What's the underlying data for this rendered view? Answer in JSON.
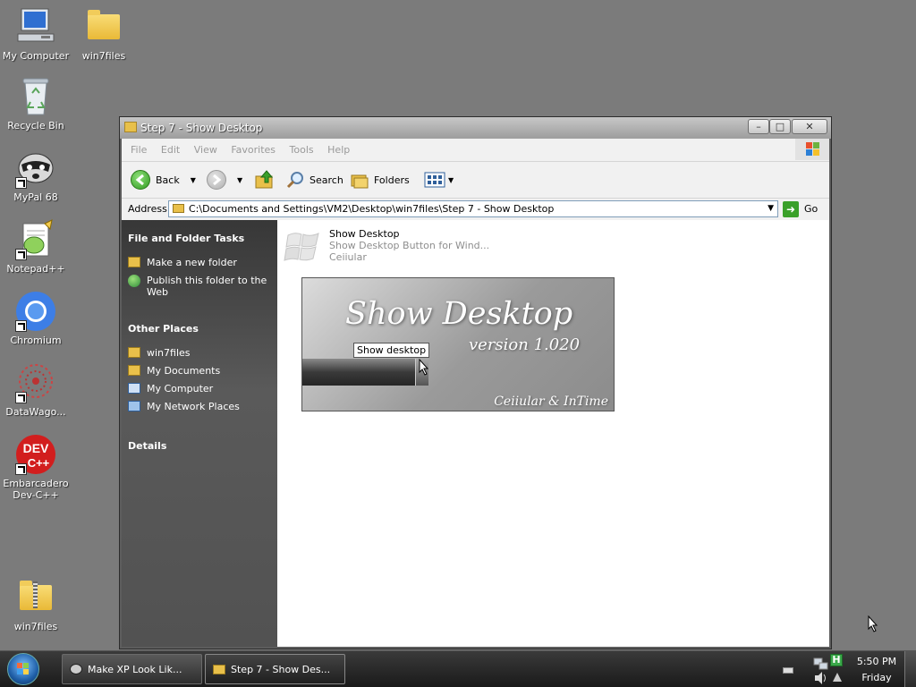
{
  "desktop": {
    "icons": [
      {
        "label": "My Computer"
      },
      {
        "label": "win7files"
      },
      {
        "label": "Recycle Bin"
      },
      {
        "label": "MyPal 68"
      },
      {
        "label": "Notepad++"
      },
      {
        "label": "Chromium"
      },
      {
        "label": "DataWago..."
      },
      {
        "label": "Embarcadero Dev-C++"
      },
      {
        "label": "win7files"
      }
    ]
  },
  "window": {
    "title": "Step 7 - Show Desktop",
    "menu": [
      "File",
      "Edit",
      "View",
      "Favorites",
      "Tools",
      "Help"
    ],
    "toolbar": {
      "back": "Back",
      "search": "Search",
      "folders": "Folders"
    },
    "address": {
      "label": "Address",
      "path": "C:\\Documents and Settings\\VM2\\Desktop\\win7files\\Step 7 - Show Desktop",
      "go": "Go"
    },
    "left_pane": {
      "tasks_heading": "File and Folder Tasks",
      "tasks": [
        "Make a new folder",
        "Publish this folder to the Web"
      ],
      "places_heading": "Other Places",
      "places": [
        "win7files",
        "My Documents",
        "My Computer",
        "My Network Places"
      ],
      "details_heading": "Details"
    },
    "file": {
      "name": "Show Desktop",
      "description": "Show Desktop Button for Wind...",
      "author": "Ceiiular"
    },
    "preview": {
      "title": "Show Desktop",
      "version": "version 1.020",
      "tooltip": "Show desktop",
      "credit": "Ceiiular & InTime"
    }
  },
  "taskbar": {
    "buttons": [
      "Make XP Look Lik...",
      "Step 7 - Show Des..."
    ],
    "tray_letter": "H",
    "time": "5:50 PM",
    "day": "Friday"
  }
}
